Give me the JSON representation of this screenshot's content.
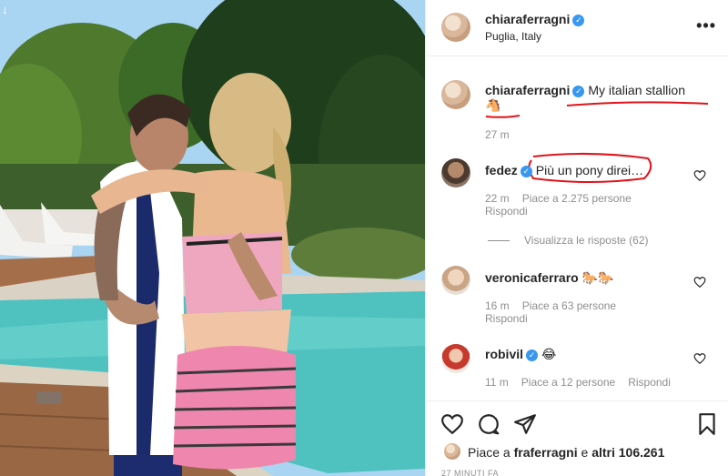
{
  "post": {
    "author": "chiaraferragni",
    "location": "Puglia, Italy",
    "more_icon": "•••"
  },
  "caption": {
    "author": "chiaraferragni",
    "text": "My italian stallion",
    "emoji": "🐴",
    "time": "27 m"
  },
  "comments": [
    {
      "author": "fedez",
      "text": "Più un pony direi…",
      "time": "22 m",
      "likes": "Piace a 2.275 persone",
      "reply": "Rispondi",
      "view_replies": "Visualizza le risposte (62)"
    },
    {
      "author": "veronicaferraro",
      "text": "🐎🐎",
      "time": "16 m",
      "likes": "Piace a 63 persone",
      "reply": "Rispondi"
    },
    {
      "author": "robivil",
      "text": "😂",
      "time": "11 m",
      "likes": "Piace a 12 persone",
      "reply": "Rispondi"
    }
  ],
  "likes": {
    "prefix": "Piace a ",
    "user": "fraferragni",
    "mid": " e ",
    "others": "altri 106.261"
  },
  "footer_time": "27 MINUTI FA",
  "colors": {
    "verified": "#3897f0",
    "ink": "#e0141c",
    "muted": "#8e8e8e"
  },
  "icons": [
    "heart-icon",
    "comment-icon",
    "share-icon",
    "bookmark-icon",
    "verified-icon",
    "more-icon"
  ]
}
